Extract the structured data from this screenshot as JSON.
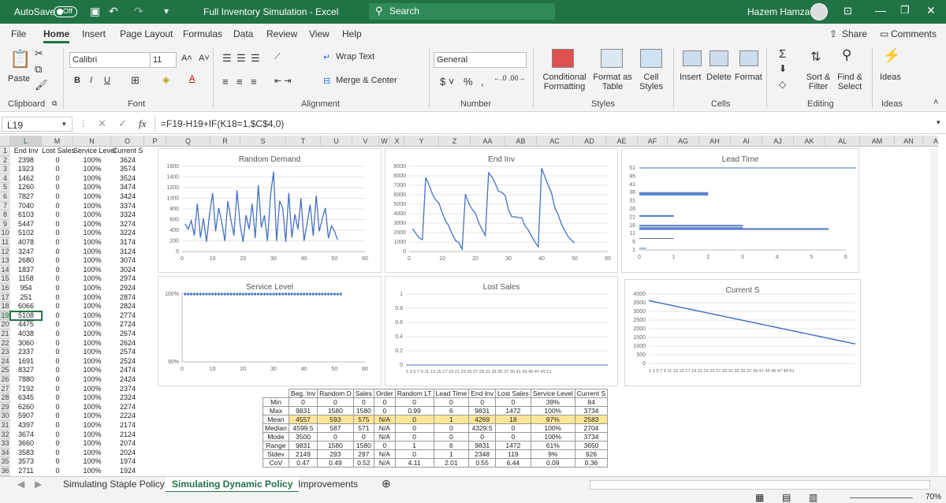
{
  "titlebar": {
    "autosave": "AutoSave",
    "toggle": "Off",
    "title": "Full Inventory Simulation  -  Excel",
    "search": "Search",
    "user": "Hazem Hamza"
  },
  "tabs": [
    "File",
    "Home",
    "Insert",
    "Page Layout",
    "Formulas",
    "Data",
    "Review",
    "View",
    "Help"
  ],
  "share": "Share",
  "comments": "Comments",
  "ribbon": {
    "font_name": "Calibri",
    "font_size": "11",
    "wrap": "Wrap Text",
    "merge": "Merge & Center",
    "number_format": "General",
    "conditional": "Conditional Formatting",
    "format_table": "Format as Table",
    "cell_styles": "Cell Styles",
    "insert": "Insert",
    "delete": "Delete",
    "format": "Format",
    "sort": "Sort & Filter",
    "find": "Find & Select",
    "ideas": "Ideas",
    "paste": "Paste",
    "groups": {
      "clipboard": "Clipboard",
      "font": "Font",
      "alignment": "Alignment",
      "number": "Number",
      "styles": "Styles",
      "cells": "Cells",
      "editing": "Editing",
      "ideas": "Ideas"
    }
  },
  "namebox": "L19",
  "formula": "=F19-H19+IF(K18=1,$C$4,0)",
  "fx": "fx",
  "columns": [
    "L",
    "M",
    "N",
    "O",
    "P",
    "Q",
    "R",
    "S",
    "T",
    "U",
    "V",
    "W",
    "X",
    "Y",
    "Z",
    "AA",
    "AB",
    "AC",
    "AD",
    "AE",
    "AF",
    "AG",
    "AH",
    "AI",
    "AJ",
    "AK",
    "AL",
    "AM",
    "AN",
    "AO",
    "AI"
  ],
  "headers": {
    "end_inv": "End Inv",
    "lost_sales": "Lost Sales",
    "service_level": "Service Level",
    "current_s": "Current S"
  },
  "rows": [
    [
      "2398",
      "0",
      "100%",
      "3624"
    ],
    [
      "1923",
      "0",
      "100%",
      "3574"
    ],
    [
      "1462",
      "0",
      "100%",
      "3524"
    ],
    [
      "1260",
      "0",
      "100%",
      "3474"
    ],
    [
      "7827",
      "0",
      "100%",
      "3424"
    ],
    [
      "7040",
      "0",
      "100%",
      "3374"
    ],
    [
      "6103",
      "0",
      "100%",
      "3324"
    ],
    [
      "5447",
      "0",
      "100%",
      "3274"
    ],
    [
      "5102",
      "0",
      "100%",
      "3224"
    ],
    [
      "4078",
      "0",
      "100%",
      "3174"
    ],
    [
      "3247",
      "0",
      "100%",
      "3124"
    ],
    [
      "2680",
      "0",
      "100%",
      "3074"
    ],
    [
      "1837",
      "0",
      "100%",
      "3024"
    ],
    [
      "1158",
      "0",
      "100%",
      "2974"
    ],
    [
      "954",
      "0",
      "100%",
      "2924"
    ],
    [
      "251",
      "0",
      "100%",
      "2874"
    ],
    [
      "6066",
      "0",
      "100%",
      "2824"
    ],
    [
      "5108",
      "0",
      "100%",
      "2774"
    ],
    [
      "4475",
      "0",
      "100%",
      "2724"
    ],
    [
      "4038",
      "0",
      "100%",
      "2674"
    ],
    [
      "3060",
      "0",
      "100%",
      "2624"
    ],
    [
      "2337",
      "0",
      "100%",
      "2574"
    ],
    [
      "1691",
      "0",
      "100%",
      "2524"
    ],
    [
      "8327",
      "0",
      "100%",
      "2474"
    ],
    [
      "7880",
      "0",
      "100%",
      "2424"
    ],
    [
      "7192",
      "0",
      "100%",
      "2374"
    ],
    [
      "6345",
      "0",
      "100%",
      "2324"
    ],
    [
      "6260",
      "0",
      "100%",
      "2274"
    ],
    [
      "5907",
      "0",
      "100%",
      "2224"
    ],
    [
      "4397",
      "0",
      "100%",
      "2174"
    ],
    [
      "3674",
      "0",
      "100%",
      "2124"
    ],
    [
      "3660",
      "0",
      "100%",
      "2074"
    ],
    [
      "3583",
      "0",
      "100%",
      "2024"
    ],
    [
      "3573",
      "0",
      "100%",
      "1974"
    ],
    [
      "2711",
      "0",
      "100%",
      "1924"
    ],
    [
      "2258",
      "0",
      "100%",
      "1874"
    ]
  ],
  "stats": {
    "headers": [
      "",
      "Beg. Inv",
      "Random D",
      "Sales",
      "Order",
      "Random LT",
      "Lead Time",
      "End Inv",
      "Lost Sales",
      "Service Level",
      "Current S"
    ],
    "rows": [
      [
        "Min",
        "0",
        "0",
        "0",
        "0",
        "0",
        "0",
        "0",
        "0",
        "39%",
        "84"
      ],
      [
        "Max",
        "9831",
        "1580",
        "1580",
        "0",
        "0.99",
        "6",
        "9831",
        "1472",
        "100%",
        "3734"
      ],
      [
        "Mean",
        "4557",
        "593",
        "575",
        "N/A",
        "0",
        "1",
        "4269",
        "18",
        "97%",
        "2583"
      ],
      [
        "Median",
        "4599.5",
        "587",
        "571",
        "N/A",
        "0",
        "0",
        "4329.5",
        "0",
        "100%",
        "2704"
      ],
      [
        "Mode",
        "3500",
        "0",
        "0",
        "N/A",
        "0",
        "0",
        "0",
        "0",
        "100%",
        "3734"
      ],
      [
        "Range",
        "9831",
        "1580",
        "1580",
        "0",
        "1",
        "6",
        "9831",
        "1472",
        "61%",
        "3650"
      ],
      [
        "Stdev",
        "2149",
        "293",
        "297",
        "N/A",
        "0",
        "1",
        "2348",
        "119",
        "9%",
        "926"
      ],
      [
        "CoV",
        "0.47",
        "0.49",
        "0.52",
        "N/A",
        "4.11",
        "2.01",
        "0.55",
        "6.44",
        "0.09",
        "0.36"
      ]
    ]
  },
  "chart_data": [
    {
      "type": "line",
      "title": "Random Demand",
      "x": [
        1,
        2,
        3,
        4,
        5,
        6,
        7,
        8,
        9,
        10,
        11,
        12,
        13,
        14,
        15,
        16,
        17,
        18,
        19,
        20,
        21,
        22,
        23,
        24,
        25,
        26,
        27,
        28,
        29,
        30,
        31,
        32,
        33,
        34,
        35,
        36,
        37,
        38,
        39,
        40,
        41,
        42,
        43,
        44,
        45,
        46,
        47,
        48,
        49,
        50,
        51
      ],
      "values": [
        520,
        420,
        580,
        300,
        900,
        260,
        620,
        180,
        700,
        1100,
        380,
        820,
        560,
        200,
        950,
        600,
        300,
        1150,
        520,
        180,
        680,
        420,
        900,
        250,
        1250,
        450,
        680,
        200,
        1050,
        1500,
        200,
        950,
        820,
        180,
        1100,
        260,
        700,
        420,
        1000,
        200,
        520,
        880,
        300,
        1050,
        380,
        620,
        820,
        250,
        480,
        380,
        220
      ],
      "xlim": [
        0,
        60
      ],
      "ylim": [
        0,
        1600
      ],
      "xticks": [
        0,
        10,
        20,
        30,
        40,
        50,
        60
      ],
      "yticks": [
        0,
        200,
        400,
        600,
        800,
        1000,
        1200,
        1400,
        1600
      ],
      "color": "#4472c4"
    },
    {
      "type": "line",
      "title": "End Inv",
      "x": [
        1,
        2,
        3,
        4,
        5,
        6,
        7,
        8,
        9,
        10,
        11,
        12,
        13,
        14,
        15,
        16,
        17,
        18,
        19,
        20,
        21,
        22,
        23,
        24,
        25,
        26,
        27,
        28,
        29,
        30,
        31,
        32,
        33,
        34,
        35,
        36,
        37,
        38,
        39,
        40,
        41,
        42,
        43,
        44,
        45,
        46,
        47,
        48,
        49,
        50
      ],
      "values": [
        2398,
        1923,
        1462,
        1260,
        7827,
        7040,
        6103,
        5447,
        5102,
        4078,
        3247,
        2680,
        1837,
        1158,
        954,
        251,
        6066,
        5108,
        4475,
        4038,
        3060,
        2337,
        1691,
        8327,
        7880,
        7192,
        6345,
        6260,
        5907,
        4397,
        3674,
        3660,
        3583,
        3573,
        2711,
        2258,
        1600,
        1000,
        500,
        8800,
        7900,
        7000,
        6200,
        4600,
        3900,
        2900,
        2200,
        1600,
        1200,
        900
      ],
      "xlim": [
        0,
        60
      ],
      "ylim": [
        0,
        9000
      ],
      "xticks": [
        0,
        10,
        20,
        30,
        40,
        50,
        60
      ],
      "yticks": [
        0,
        1000,
        2000,
        3000,
        4000,
        5000,
        6000,
        7000,
        8000,
        9000
      ],
      "color": "#4472c4"
    },
    {
      "type": "bar",
      "title": "Lead Time",
      "xlim": [
        0,
        6
      ],
      "ylim": [
        1,
        51
      ],
      "xticks": [
        0,
        1,
        2,
        3,
        4,
        5,
        6
      ],
      "yticks": [
        1,
        6,
        11,
        16,
        21,
        26,
        31,
        36,
        41,
        46,
        51
      ],
      "color": "#4472c4"
    },
    {
      "type": "scatter",
      "title": "Service Level",
      "x": [
        1,
        2,
        3,
        4,
        5,
        6,
        7,
        8,
        9,
        10,
        11,
        12,
        13,
        14,
        15,
        16,
        17,
        18,
        19,
        20,
        21,
        22,
        23,
        24,
        25,
        26,
        27,
        28,
        29,
        30,
        31,
        32,
        33,
        34,
        35,
        36,
        37,
        38,
        39,
        40,
        41,
        42,
        43,
        44,
        45,
        46,
        47,
        48,
        49,
        50,
        51,
        52
      ],
      "value": 1.0,
      "xlim": [
        0,
        60
      ],
      "ylim": [
        0.9,
        1.0
      ],
      "xticks": [
        0,
        10,
        20,
        30,
        40,
        50,
        60
      ],
      "yticks": [
        "90%",
        "100%"
      ],
      "color": "#4472c4"
    },
    {
      "type": "line",
      "title": "Lost Sales",
      "ylim": [
        0,
        1
      ],
      "yticks": [
        0,
        0.2,
        0.4,
        0.6,
        0.8,
        1
      ],
      "xlabels": "1 3 5 7 9 11 13 15 17 19 21 23 25 27 29 31 33 35 37 39 41 43 45 47 49 51",
      "color": "#4472c4"
    },
    {
      "type": "line",
      "title": "Current S",
      "start": 3624,
      "step": -50,
      "count": 51,
      "ylim": [
        0,
        4000
      ],
      "yticks": [
        0,
        500,
        1000,
        1500,
        2000,
        2500,
        3000,
        3500,
        4000
      ],
      "xlabels": "1 3 5 7 9 11 13 15 17 19 21 23 25 27 29 31 33 35 37 39 41 43 45 47 49 51",
      "color": "#4472c4"
    }
  ],
  "sheets": [
    "Simulating Staple Policy",
    "Simulating Dynamic Policy",
    "Improvements"
  ],
  "zoom": "70%"
}
